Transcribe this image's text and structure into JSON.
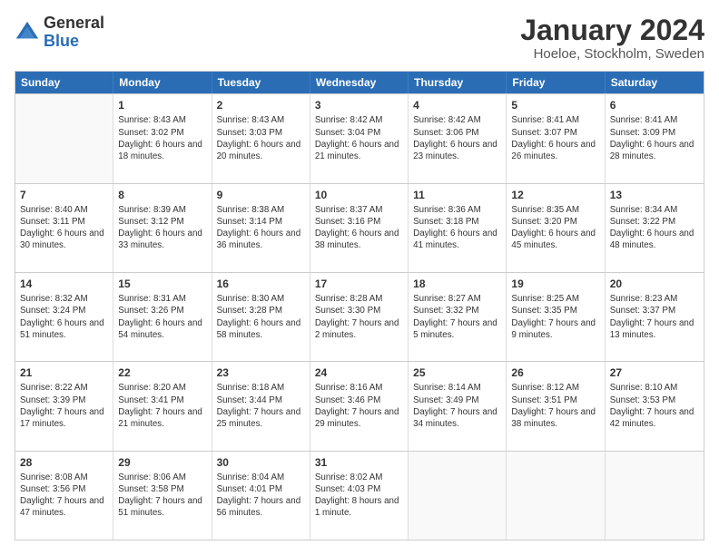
{
  "header": {
    "logo_general": "General",
    "logo_blue": "Blue",
    "month_title": "January 2024",
    "location": "Hoeloe, Stockholm, Sweden"
  },
  "calendar": {
    "days": [
      "Sunday",
      "Monday",
      "Tuesday",
      "Wednesday",
      "Thursday",
      "Friday",
      "Saturday"
    ],
    "weeks": [
      [
        {
          "day": "",
          "empty": true
        },
        {
          "day": "1",
          "sunrise": "Sunrise: 8:43 AM",
          "sunset": "Sunset: 3:02 PM",
          "daylight": "Daylight: 6 hours and 18 minutes."
        },
        {
          "day": "2",
          "sunrise": "Sunrise: 8:43 AM",
          "sunset": "Sunset: 3:03 PM",
          "daylight": "Daylight: 6 hours and 20 minutes."
        },
        {
          "day": "3",
          "sunrise": "Sunrise: 8:42 AM",
          "sunset": "Sunset: 3:04 PM",
          "daylight": "Daylight: 6 hours and 21 minutes."
        },
        {
          "day": "4",
          "sunrise": "Sunrise: 8:42 AM",
          "sunset": "Sunset: 3:06 PM",
          "daylight": "Daylight: 6 hours and 23 minutes."
        },
        {
          "day": "5",
          "sunrise": "Sunrise: 8:41 AM",
          "sunset": "Sunset: 3:07 PM",
          "daylight": "Daylight: 6 hours and 26 minutes."
        },
        {
          "day": "6",
          "sunrise": "Sunrise: 8:41 AM",
          "sunset": "Sunset: 3:09 PM",
          "daylight": "Daylight: 6 hours and 28 minutes."
        }
      ],
      [
        {
          "day": "7",
          "sunrise": "Sunrise: 8:40 AM",
          "sunset": "Sunset: 3:11 PM",
          "daylight": "Daylight: 6 hours and 30 minutes."
        },
        {
          "day": "8",
          "sunrise": "Sunrise: 8:39 AM",
          "sunset": "Sunset: 3:12 PM",
          "daylight": "Daylight: 6 hours and 33 minutes."
        },
        {
          "day": "9",
          "sunrise": "Sunrise: 8:38 AM",
          "sunset": "Sunset: 3:14 PM",
          "daylight": "Daylight: 6 hours and 36 minutes."
        },
        {
          "day": "10",
          "sunrise": "Sunrise: 8:37 AM",
          "sunset": "Sunset: 3:16 PM",
          "daylight": "Daylight: 6 hours and 38 minutes."
        },
        {
          "day": "11",
          "sunrise": "Sunrise: 8:36 AM",
          "sunset": "Sunset: 3:18 PM",
          "daylight": "Daylight: 6 hours and 41 minutes."
        },
        {
          "day": "12",
          "sunrise": "Sunrise: 8:35 AM",
          "sunset": "Sunset: 3:20 PM",
          "daylight": "Daylight: 6 hours and 45 minutes."
        },
        {
          "day": "13",
          "sunrise": "Sunrise: 8:34 AM",
          "sunset": "Sunset: 3:22 PM",
          "daylight": "Daylight: 6 hours and 48 minutes."
        }
      ],
      [
        {
          "day": "14",
          "sunrise": "Sunrise: 8:32 AM",
          "sunset": "Sunset: 3:24 PM",
          "daylight": "Daylight: 6 hours and 51 minutes."
        },
        {
          "day": "15",
          "sunrise": "Sunrise: 8:31 AM",
          "sunset": "Sunset: 3:26 PM",
          "daylight": "Daylight: 6 hours and 54 minutes."
        },
        {
          "day": "16",
          "sunrise": "Sunrise: 8:30 AM",
          "sunset": "Sunset: 3:28 PM",
          "daylight": "Daylight: 6 hours and 58 minutes."
        },
        {
          "day": "17",
          "sunrise": "Sunrise: 8:28 AM",
          "sunset": "Sunset: 3:30 PM",
          "daylight": "Daylight: 7 hours and 2 minutes."
        },
        {
          "day": "18",
          "sunrise": "Sunrise: 8:27 AM",
          "sunset": "Sunset: 3:32 PM",
          "daylight": "Daylight: 7 hours and 5 minutes."
        },
        {
          "day": "19",
          "sunrise": "Sunrise: 8:25 AM",
          "sunset": "Sunset: 3:35 PM",
          "daylight": "Daylight: 7 hours and 9 minutes."
        },
        {
          "day": "20",
          "sunrise": "Sunrise: 8:23 AM",
          "sunset": "Sunset: 3:37 PM",
          "daylight": "Daylight: 7 hours and 13 minutes."
        }
      ],
      [
        {
          "day": "21",
          "sunrise": "Sunrise: 8:22 AM",
          "sunset": "Sunset: 3:39 PM",
          "daylight": "Daylight: 7 hours and 17 minutes."
        },
        {
          "day": "22",
          "sunrise": "Sunrise: 8:20 AM",
          "sunset": "Sunset: 3:41 PM",
          "daylight": "Daylight: 7 hours and 21 minutes."
        },
        {
          "day": "23",
          "sunrise": "Sunrise: 8:18 AM",
          "sunset": "Sunset: 3:44 PM",
          "daylight": "Daylight: 7 hours and 25 minutes."
        },
        {
          "day": "24",
          "sunrise": "Sunrise: 8:16 AM",
          "sunset": "Sunset: 3:46 PM",
          "daylight": "Daylight: 7 hours and 29 minutes."
        },
        {
          "day": "25",
          "sunrise": "Sunrise: 8:14 AM",
          "sunset": "Sunset: 3:49 PM",
          "daylight": "Daylight: 7 hours and 34 minutes."
        },
        {
          "day": "26",
          "sunrise": "Sunrise: 8:12 AM",
          "sunset": "Sunset: 3:51 PM",
          "daylight": "Daylight: 7 hours and 38 minutes."
        },
        {
          "day": "27",
          "sunrise": "Sunrise: 8:10 AM",
          "sunset": "Sunset: 3:53 PM",
          "daylight": "Daylight: 7 hours and 42 minutes."
        }
      ],
      [
        {
          "day": "28",
          "sunrise": "Sunrise: 8:08 AM",
          "sunset": "Sunset: 3:56 PM",
          "daylight": "Daylight: 7 hours and 47 minutes."
        },
        {
          "day": "29",
          "sunrise": "Sunrise: 8:06 AM",
          "sunset": "Sunset: 3:58 PM",
          "daylight": "Daylight: 7 hours and 51 minutes."
        },
        {
          "day": "30",
          "sunrise": "Sunrise: 8:04 AM",
          "sunset": "Sunset: 4:01 PM",
          "daylight": "Daylight: 7 hours and 56 minutes."
        },
        {
          "day": "31",
          "sunrise": "Sunrise: 8:02 AM",
          "sunset": "Sunset: 4:03 PM",
          "daylight": "Daylight: 8 hours and 1 minute."
        },
        {
          "day": "",
          "empty": true
        },
        {
          "day": "",
          "empty": true
        },
        {
          "day": "",
          "empty": true
        }
      ]
    ]
  }
}
